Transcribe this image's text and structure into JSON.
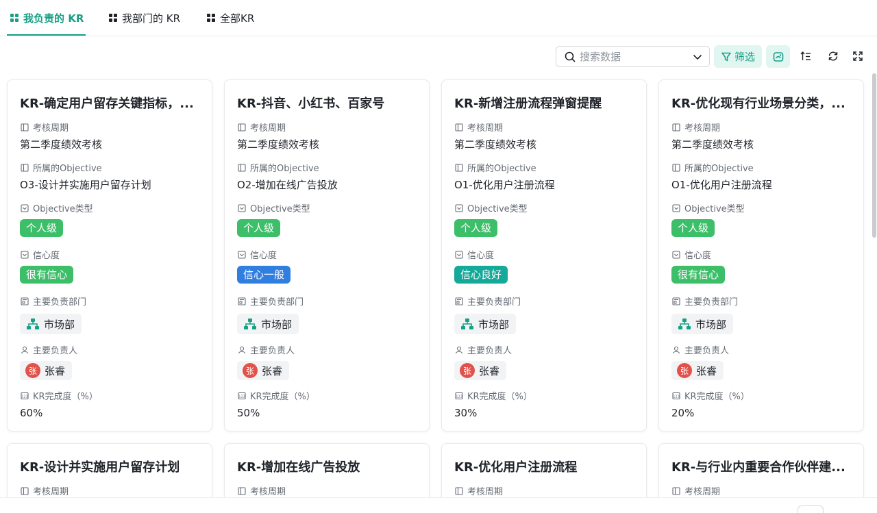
{
  "tabs": [
    {
      "label": "我负责的 KR",
      "active": true
    },
    {
      "label": "我部门的 KR",
      "active": false
    },
    {
      "label": "全部KR",
      "active": false
    }
  ],
  "toolbar": {
    "search_placeholder": "搜索数据",
    "filter_label": "筛选",
    "icons": [
      "search-icon",
      "chevron-down-icon",
      "filter-icon",
      "card-view-icon",
      "sort-icon",
      "refresh-icon",
      "fullscreen-icon"
    ]
  },
  "labels": {
    "period": "考核周期",
    "objective": "所属的Objective",
    "objective_type": "Objective类型",
    "confidence": "信心度",
    "department": "主要负责部门",
    "owner": "主要负责人",
    "progress": "KR完成度（%）"
  },
  "colors": {
    "accent": "#16a085",
    "tag_green": "#3dbf6a",
    "tag_blue": "#2f7ee0",
    "tag_teal": "#15a99a",
    "avatar": "#e2514a"
  },
  "cards": [
    {
      "title": "KR-确定用户留存关键指标，...",
      "period": "第二季度绩效考核",
      "objective": "O3-设计并实施用户留存计划",
      "objective_type": "个人级",
      "confidence": "很有信心",
      "department": "市场部",
      "owner_avatar": "张",
      "owner": "张睿",
      "progress": "60%"
    },
    {
      "title": "KR-抖音、小红书、百家号",
      "period": "第二季度绩效考核",
      "objective": "O2-增加在线广告投放",
      "objective_type": "个人级",
      "confidence": "信心一般",
      "department": "市场部",
      "owner_avatar": "张",
      "owner": "张睿",
      "progress": "50%"
    },
    {
      "title": "KR-新增注册流程弹窗提醒",
      "period": "第二季度绩效考核",
      "objective": "O1-优化用户注册流程",
      "objective_type": "个人级",
      "confidence": "信心良好",
      "department": "市场部",
      "owner_avatar": "张",
      "owner": "张睿",
      "progress": "30%"
    },
    {
      "title": "KR-优化现有行业场景分类，...",
      "period": "第二季度绩效考核",
      "objective": "O1-优化用户注册流程",
      "objective_type": "个人级",
      "confidence": "很有信心",
      "department": "市场部",
      "owner_avatar": "张",
      "owner": "张睿",
      "progress": "20%"
    }
  ],
  "cards_row2": [
    {
      "title": "KR-设计并实施用户留存计划"
    },
    {
      "title": "KR-增加在线广告投放"
    },
    {
      "title": "KR-优化用户注册流程"
    },
    {
      "title": "KR-与行业内重要合作伙伴建..."
    }
  ]
}
